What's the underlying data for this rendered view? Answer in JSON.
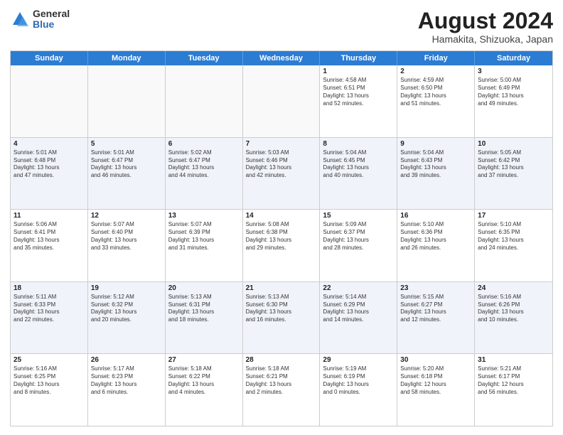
{
  "logo": {
    "general": "General",
    "blue": "Blue"
  },
  "title": "August 2024",
  "subtitle": "Hamakita, Shizuoka, Japan",
  "days_of_week": [
    "Sunday",
    "Monday",
    "Tuesday",
    "Wednesday",
    "Thursday",
    "Friday",
    "Saturday"
  ],
  "weeks": [
    [
      {
        "day": "",
        "info": ""
      },
      {
        "day": "",
        "info": ""
      },
      {
        "day": "",
        "info": ""
      },
      {
        "day": "",
        "info": ""
      },
      {
        "day": "1",
        "info": "Sunrise: 4:58 AM\nSunset: 6:51 PM\nDaylight: 13 hours\nand 52 minutes."
      },
      {
        "day": "2",
        "info": "Sunrise: 4:59 AM\nSunset: 6:50 PM\nDaylight: 13 hours\nand 51 minutes."
      },
      {
        "day": "3",
        "info": "Sunrise: 5:00 AM\nSunset: 6:49 PM\nDaylight: 13 hours\nand 49 minutes."
      }
    ],
    [
      {
        "day": "4",
        "info": "Sunrise: 5:01 AM\nSunset: 6:48 PM\nDaylight: 13 hours\nand 47 minutes."
      },
      {
        "day": "5",
        "info": "Sunrise: 5:01 AM\nSunset: 6:47 PM\nDaylight: 13 hours\nand 46 minutes."
      },
      {
        "day": "6",
        "info": "Sunrise: 5:02 AM\nSunset: 6:47 PM\nDaylight: 13 hours\nand 44 minutes."
      },
      {
        "day": "7",
        "info": "Sunrise: 5:03 AM\nSunset: 6:46 PM\nDaylight: 13 hours\nand 42 minutes."
      },
      {
        "day": "8",
        "info": "Sunrise: 5:04 AM\nSunset: 6:45 PM\nDaylight: 13 hours\nand 40 minutes."
      },
      {
        "day": "9",
        "info": "Sunrise: 5:04 AM\nSunset: 6:43 PM\nDaylight: 13 hours\nand 39 minutes."
      },
      {
        "day": "10",
        "info": "Sunrise: 5:05 AM\nSunset: 6:42 PM\nDaylight: 13 hours\nand 37 minutes."
      }
    ],
    [
      {
        "day": "11",
        "info": "Sunrise: 5:06 AM\nSunset: 6:41 PM\nDaylight: 13 hours\nand 35 minutes."
      },
      {
        "day": "12",
        "info": "Sunrise: 5:07 AM\nSunset: 6:40 PM\nDaylight: 13 hours\nand 33 minutes."
      },
      {
        "day": "13",
        "info": "Sunrise: 5:07 AM\nSunset: 6:39 PM\nDaylight: 13 hours\nand 31 minutes."
      },
      {
        "day": "14",
        "info": "Sunrise: 5:08 AM\nSunset: 6:38 PM\nDaylight: 13 hours\nand 29 minutes."
      },
      {
        "day": "15",
        "info": "Sunrise: 5:09 AM\nSunset: 6:37 PM\nDaylight: 13 hours\nand 28 minutes."
      },
      {
        "day": "16",
        "info": "Sunrise: 5:10 AM\nSunset: 6:36 PM\nDaylight: 13 hours\nand 26 minutes."
      },
      {
        "day": "17",
        "info": "Sunrise: 5:10 AM\nSunset: 6:35 PM\nDaylight: 13 hours\nand 24 minutes."
      }
    ],
    [
      {
        "day": "18",
        "info": "Sunrise: 5:11 AM\nSunset: 6:33 PM\nDaylight: 13 hours\nand 22 minutes."
      },
      {
        "day": "19",
        "info": "Sunrise: 5:12 AM\nSunset: 6:32 PM\nDaylight: 13 hours\nand 20 minutes."
      },
      {
        "day": "20",
        "info": "Sunrise: 5:13 AM\nSunset: 6:31 PM\nDaylight: 13 hours\nand 18 minutes."
      },
      {
        "day": "21",
        "info": "Sunrise: 5:13 AM\nSunset: 6:30 PM\nDaylight: 13 hours\nand 16 minutes."
      },
      {
        "day": "22",
        "info": "Sunrise: 5:14 AM\nSunset: 6:29 PM\nDaylight: 13 hours\nand 14 minutes."
      },
      {
        "day": "23",
        "info": "Sunrise: 5:15 AM\nSunset: 6:27 PM\nDaylight: 13 hours\nand 12 minutes."
      },
      {
        "day": "24",
        "info": "Sunrise: 5:16 AM\nSunset: 6:26 PM\nDaylight: 13 hours\nand 10 minutes."
      }
    ],
    [
      {
        "day": "25",
        "info": "Sunrise: 5:16 AM\nSunset: 6:25 PM\nDaylight: 13 hours\nand 8 minutes."
      },
      {
        "day": "26",
        "info": "Sunrise: 5:17 AM\nSunset: 6:23 PM\nDaylight: 13 hours\nand 6 minutes."
      },
      {
        "day": "27",
        "info": "Sunrise: 5:18 AM\nSunset: 6:22 PM\nDaylight: 13 hours\nand 4 minutes."
      },
      {
        "day": "28",
        "info": "Sunrise: 5:18 AM\nSunset: 6:21 PM\nDaylight: 13 hours\nand 2 minutes."
      },
      {
        "day": "29",
        "info": "Sunrise: 5:19 AM\nSunset: 6:19 PM\nDaylight: 13 hours\nand 0 minutes."
      },
      {
        "day": "30",
        "info": "Sunrise: 5:20 AM\nSunset: 6:18 PM\nDaylight: 12 hours\nand 58 minutes."
      },
      {
        "day": "31",
        "info": "Sunrise: 5:21 AM\nSunset: 6:17 PM\nDaylight: 12 hours\nand 56 minutes."
      }
    ]
  ]
}
